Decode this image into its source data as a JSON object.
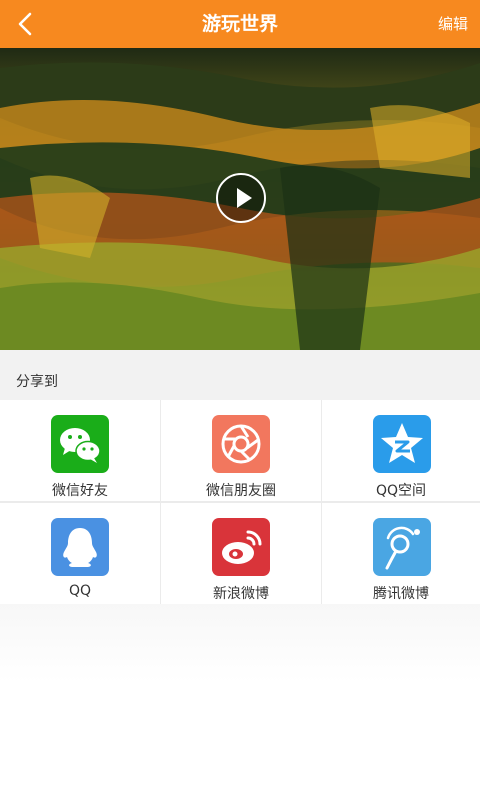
{
  "header": {
    "title": "游玩世界",
    "edit_label": "编辑",
    "background": "#f7891f"
  },
  "share": {
    "label": "分享到",
    "targets": [
      {
        "name": "微信好友",
        "icon": "wechat-icon",
        "color": "#1aad19"
      },
      {
        "name": "微信朋友圈",
        "icon": "moments-icon",
        "color": "#f2775e"
      },
      {
        "name": "QQ空间",
        "icon": "qzone-icon",
        "color": "#2a9cea"
      },
      {
        "name": "QQ",
        "icon": "qq-icon",
        "color": "#4a91e2"
      },
      {
        "name": "新浪微博",
        "icon": "weibo-icon",
        "color": "#d9343a"
      },
      {
        "name": "腾讯微博",
        "icon": "tencent-weibo-icon",
        "color": "#4aa6e3"
      }
    ]
  }
}
